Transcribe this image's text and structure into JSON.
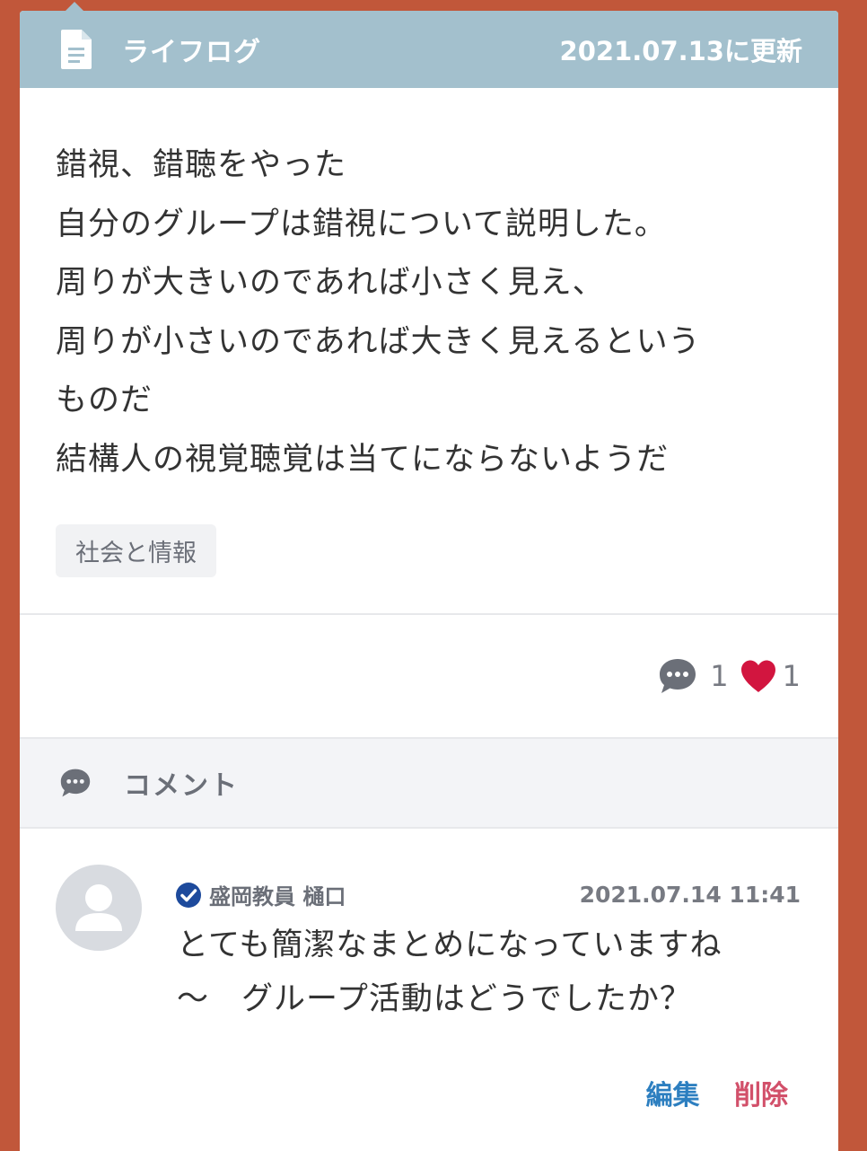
{
  "header": {
    "title": "ライフログ",
    "updated": "2021.07.13に更新"
  },
  "post": {
    "lines": [
      "錯視、錯聴をやった",
      "自分のグループは錯視について説明した。",
      "周りが大きいのであれば小さく見え、",
      "周りが小さいのであれば大きく見えるという",
      "ものだ",
      "結構人の視覚聴覚は当てにならないようだ"
    ],
    "tag": "社会と情報"
  },
  "stats": {
    "comment_count": "1",
    "like_count": "1"
  },
  "comments_section": {
    "label": "コメント"
  },
  "comment": {
    "author": "盛岡教員 樋口",
    "timestamp": "2021.07.14 11:41",
    "lines": [
      "とても簡潔なまとめになっていますね",
      "〜　グループ活動はどうでしたか？"
    ],
    "edit_label": "編集",
    "delete_label": "削除"
  },
  "colors": {
    "background": "#c1573a",
    "header": "#a3c0cd",
    "heart": "#d2153f",
    "verified": "#1d4a9c",
    "edit": "#2d7fc0",
    "delete": "#d2506a"
  },
  "icons": {
    "header": "document-icon",
    "comments": "speech-bubble-icon",
    "likes": "heart-icon",
    "verified": "check-badge-icon",
    "avatar": "user-avatar-icon"
  }
}
